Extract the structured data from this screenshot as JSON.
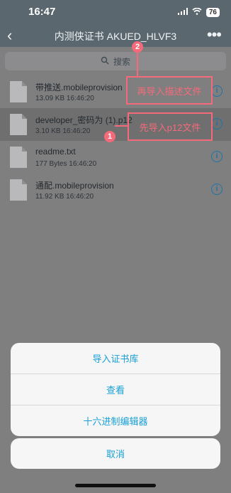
{
  "status": {
    "time": "16:47",
    "battery": "76"
  },
  "nav": {
    "title": "内测侠证书 AKUED_HLVF3",
    "more": "•••",
    "back": "‹"
  },
  "search": {
    "placeholder": "搜索"
  },
  "files": [
    {
      "name": "带推送.mobileprovision",
      "meta": "13.09 KB   16:46:20"
    },
    {
      "name": "developer_密码为 (1).p12",
      "meta": "3.10 KB   16:46:20"
    },
    {
      "name": "readme.txt",
      "meta": "177 Bytes   16:46:20"
    },
    {
      "name": "通配.mobileprovision",
      "meta": "11.92 KB   16:46:20"
    }
  ],
  "annotations": {
    "second": {
      "number": "2",
      "text": "再导入描述文件"
    },
    "first": {
      "number": "1",
      "text": "先导入p12文件"
    }
  },
  "actions": [
    "导入证书库",
    "查看",
    "十六进制编辑器"
  ],
  "cancel": "取消",
  "colors": {
    "accent": "#1aa0d6",
    "annotation": "#f56a7a"
  }
}
